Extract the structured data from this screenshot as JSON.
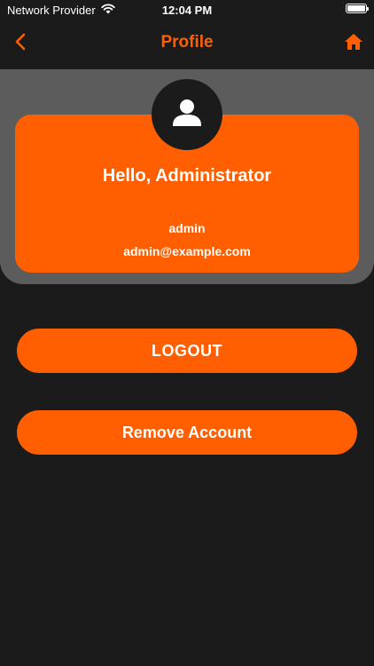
{
  "status_bar": {
    "carrier": "Network Provider",
    "time": "12:04 PM",
    "battery_level": 1.0
  },
  "nav": {
    "title": "Profile",
    "back_icon": "chevron-left-icon",
    "home_icon": "home-icon"
  },
  "profile": {
    "avatar_icon": "person-icon",
    "greeting": "Hello, Administrator",
    "username": "admin",
    "email": "admin@example.com"
  },
  "actions": {
    "logout_label": "LOGOUT",
    "remove_account_label": "Remove Account"
  },
  "colors": {
    "accent": "#ff5f00",
    "background": "#1b1b1b",
    "panel": "#5c5c5c",
    "text": "#ffffff"
  }
}
